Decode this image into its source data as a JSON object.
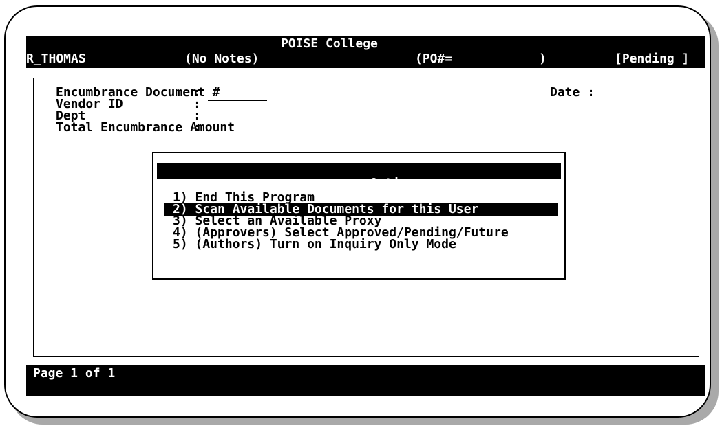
{
  "header": {
    "college_name": "POISE College",
    "user": "R_THOMAS",
    "notes": "(No Notes)",
    "po_label": "(PO#=",
    "po_close": ")",
    "status": "[Pending ]"
  },
  "form": {
    "doc_label": "Encumbrance Document #",
    "vendor_label": "Vendor ID",
    "dept_label": "Dept",
    "total_label": "Total Encumbrance Amount",
    "colon": ":",
    "date_label": "Date :"
  },
  "options": {
    "title": "Options",
    "items": [
      "1) End This Program",
      "2) Scan Available Documents for this User",
      "3) Select an Available Proxy",
      "4) (Approvers) Select Approved/Pending/Future",
      "5) (Authors) Turn on Inquiry Only Mode"
    ],
    "selected_index": 1
  },
  "footer": {
    "page_indicator": "Page 1 of 1"
  }
}
